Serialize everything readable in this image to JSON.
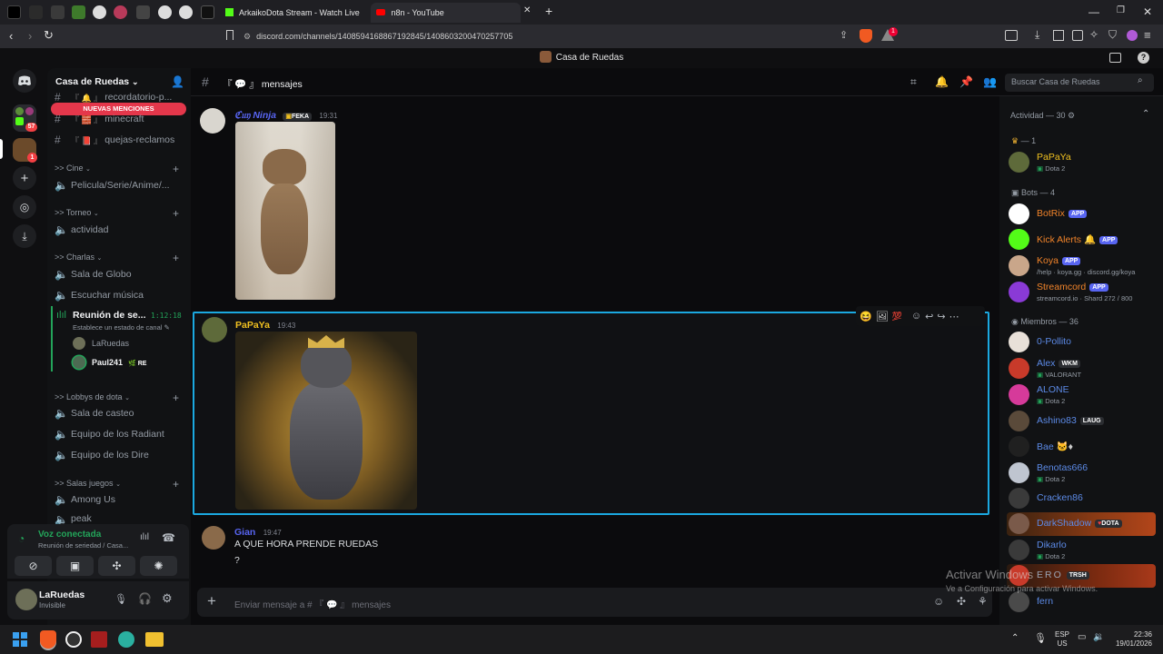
{
  "browser": {
    "tabs": [
      {
        "title": "ArkaikoDota Stream - Watch Live"
      },
      {
        "title": "n8n - YouTube"
      }
    ],
    "url": "discord.com/channels/1408594168867192845/1408603200470257705",
    "shield_count": "1"
  },
  "discord": {
    "window_title": "Casa de Ruedas",
    "server_name": "Casa de Ruedas",
    "new_mentions": "NUEVAS MENCIONES",
    "guild_badges": {
      "g1": "57",
      "g2": "1"
    },
    "channels": {
      "top": [
        {
          "name": "recordatorio-p..."
        },
        {
          "name": "minecraft"
        },
        {
          "name": "quejas-reclamos",
          "prefix": "『 📕 』"
        }
      ],
      "cine": {
        "label": ">> Cine",
        "items": [
          "Pelicula/Serie/Anime/..."
        ]
      },
      "torneo": {
        "label": ">> Torneo",
        "items": [
          "actividad"
        ]
      },
      "charlas": {
        "label": ">> Charlas",
        "items": [
          "Sala de Globo",
          "Escuchar música"
        ]
      },
      "voice_active": {
        "name": "Reunión de se...",
        "timer": "1:12:18",
        "status": "Establece un estado de canal",
        "users": [
          {
            "name": "LaRuedas"
          },
          {
            "name": "Paul241",
            "tag": "RE"
          }
        ]
      },
      "lobbys": {
        "label": ">> Lobbys de dota",
        "items": [
          "Sala de casteo",
          "Equipo de los Radiant",
          "Equipo de los Dire"
        ]
      },
      "juegos": {
        "label": ">> Salas juegos",
        "items": [
          "Among Us",
          "peak"
        ]
      }
    },
    "voice_panel": {
      "status": "Voz conectada",
      "channel": "Reunión de seriedad / Casa..."
    },
    "user": {
      "name": "LaRuedas",
      "status": "Invisible"
    },
    "channel_header": {
      "name": "mensajes",
      "prefix": "『 💬 』",
      "search_placeholder": "Buscar Casa de Ruedas"
    },
    "messages": [
      {
        "author": "ℭ𝔲𝔶 Ninja",
        "tag": "FEKA",
        "time": "19:31",
        "color": "#5865f2"
      },
      {
        "author": "PaPaYa",
        "time": "19:43",
        "color": "#f0c020"
      },
      {
        "author": "Gian",
        "time": "19:47",
        "color": "#5865f2",
        "lines": [
          "A QUE HORA PRENDE RUEDAS",
          "?"
        ]
      }
    ],
    "composer_placeholder": "Enviar mensaje a # 『 💬 』 mensajes",
    "members": {
      "activity_header": "Actividad — 30",
      "crown_group": "— 1",
      "bots_group": "Bots — 4",
      "members_group": "Miembros — 36",
      "list_activity": [
        {
          "name": "PaPaYa",
          "sub": "Dota 2",
          "color": "#f0c020"
        }
      ],
      "list_bots": [
        {
          "name": "BotRix",
          "badge": "APP",
          "color": "#f0832a"
        },
        {
          "name": "Kick Alerts",
          "badge": "APP",
          "color": "#f0832a"
        },
        {
          "name": "Koya",
          "badge": "APP",
          "sub": "/help · koya.gg · discord.gg/koya",
          "color": "#f0832a"
        },
        {
          "name": "Streamcord",
          "badge": "APP",
          "sub": "streamcord.io · Shard 272 / 800",
          "color": "#f0832a"
        }
      ],
      "list_members": [
        {
          "name": "0-Pollito",
          "color": "#5c8ae6"
        },
        {
          "name": "Alex",
          "tag": "WKM",
          "sub": "VALORANT",
          "color": "#5c8ae6"
        },
        {
          "name": "ALONE",
          "sub": "Dota 2",
          "color": "#5c8ae6"
        },
        {
          "name": "Ashino83",
          "tag": "LAUG",
          "color": "#5c8ae6"
        },
        {
          "name": "Bae",
          "color": "#5c8ae6"
        },
        {
          "name": "Benotas666",
          "sub": "Dota 2",
          "color": "#5c8ae6"
        },
        {
          "name": "Cracken86",
          "color": "#5c8ae6"
        },
        {
          "name": "DarkShadow",
          "tag": "DOTA",
          "color": "#5c8ae6"
        },
        {
          "name": "Dikarlo",
          "sub": "Dota 2",
          "color": "#5c8ae6"
        },
        {
          "name": "ERO",
          "tag": "TRSH",
          "color": "#5c8ae6"
        },
        {
          "name": "fern",
          "color": "#5c8ae6"
        }
      ]
    },
    "watermark": {
      "line1": "Activar Windows",
      "line2": "Ve a Configuración para activar Windows."
    }
  },
  "taskbar": {
    "lang1": "ESP",
    "lang2": "US",
    "time": "22:36",
    "date": "19/01/2026"
  }
}
